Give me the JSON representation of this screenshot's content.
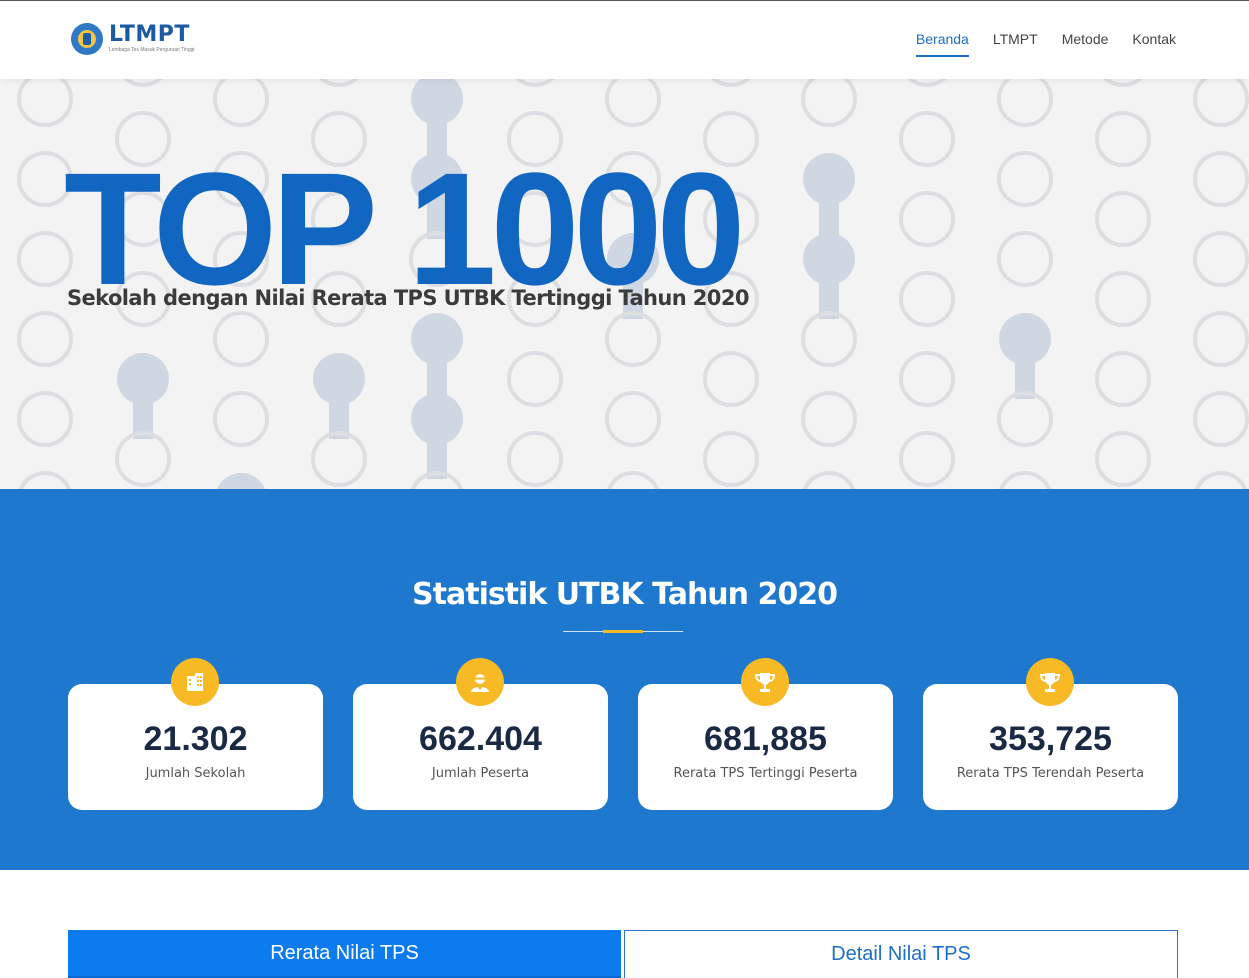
{
  "header": {
    "brand_name": "LTMPT",
    "brand_subtitle": "Lembaga Tes Masuk Perguruan Tinggi",
    "nav": [
      {
        "label": "Beranda",
        "active": true
      },
      {
        "label": "LTMPT",
        "active": false
      },
      {
        "label": "Metode",
        "active": false
      },
      {
        "label": "Kontak",
        "active": false
      }
    ]
  },
  "hero": {
    "title": "TOP 1000",
    "subtitle": "Sekolah dengan Nilai Rerata TPS UTBK Tertinggi Tahun 2020"
  },
  "stats": {
    "title": "Statistik UTBK Tahun 2020",
    "cards": [
      {
        "icon": "building-icon",
        "value": "21.302",
        "label": "Jumlah Sekolah"
      },
      {
        "icon": "student-icon",
        "value": "662.404",
        "label": "Jumlah Peserta"
      },
      {
        "icon": "trophy-icon",
        "value": "681,885",
        "label": "Rerata TPS Tertinggi Peserta"
      },
      {
        "icon": "trophy-icon",
        "value": "353,725",
        "label": "Rerata TPS Terendah Peserta"
      }
    ]
  },
  "tabs": [
    {
      "label": "Rerata Nilai TPS",
      "active": true
    },
    {
      "label": "Detail Nilai TPS",
      "active": false
    }
  ],
  "colors": {
    "primary": "#1e78cd",
    "accent": "#f7b924",
    "title_blue": "#1066c0",
    "tab_active": "#0d7bf0"
  }
}
